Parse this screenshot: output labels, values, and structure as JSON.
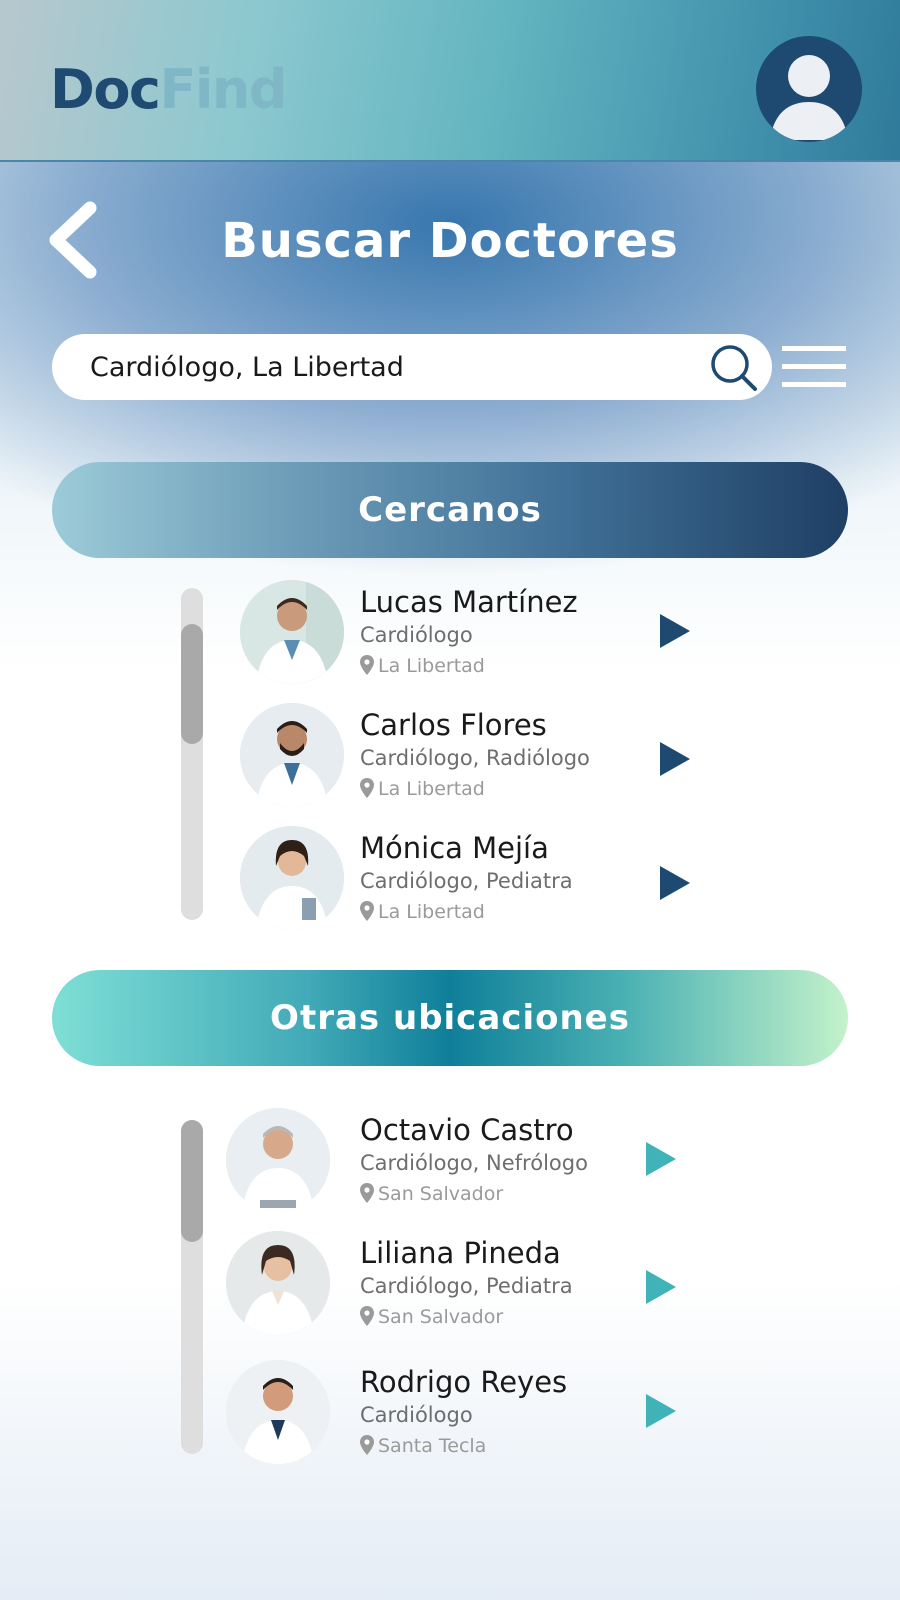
{
  "header": {
    "logo_part1": "Doc",
    "logo_part2": "Find"
  },
  "page": {
    "title": "Buscar Doctores"
  },
  "search": {
    "value": "Cardiólogo, La Libertad"
  },
  "sections": {
    "nearby": {
      "title": "Cercanos",
      "doctors": [
        {
          "name": "Lucas Martínez",
          "specialty": "Cardiólogo",
          "location": "La Libertad"
        },
        {
          "name": "Carlos Flores",
          "specialty": "Cardiólogo, Radiólogo",
          "location": "La Libertad"
        },
        {
          "name": "Mónica Mejía",
          "specialty": "Cardiólogo, Pediatra",
          "location": "La Libertad"
        }
      ]
    },
    "other": {
      "title": "Otras ubicaciones",
      "doctors": [
        {
          "name": "Octavio Castro",
          "specialty": "Cardiólogo, Nefrólogo",
          "location": "San Salvador"
        },
        {
          "name": "Liliana Pineda",
          "specialty": "Cardiólogo, Pediatra",
          "location": "San Salvador"
        },
        {
          "name": "Rodrigo Reyes",
          "specialty": "Cardiólogo",
          "location": "Santa Tecla"
        }
      ]
    }
  },
  "colors": {
    "brand_dark": "#1e4a72",
    "brand_light": "#7fb7c6",
    "accent_teal": "#3fb3b8"
  },
  "icons": [
    "user-avatar-icon",
    "back-chevron-icon",
    "search-icon",
    "hamburger-menu-icon",
    "location-pin-icon",
    "play-arrow-icon"
  ]
}
